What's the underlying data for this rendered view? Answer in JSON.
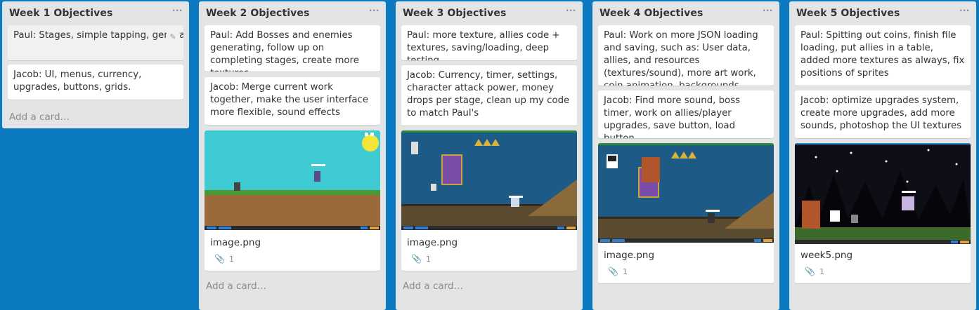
{
  "lists": [
    {
      "title": "Week 1 Objectives",
      "menu": "···",
      "cards": [
        {
          "text": "Paul: Stages, simple tapping, generate placeholder stages, timing."
        },
        {
          "text": "Jacob: UI, menus, currency, upgrades, buttons, grids."
        }
      ],
      "add_card": "Add a card…"
    },
    {
      "title": "Week 2 Objectives",
      "menu": "···",
      "cards": [
        {
          "text": "Paul: Add Bosses and enemies generating, follow up on completing stages, create more textures"
        },
        {
          "text": "Jacob: Merge current work together, make the user interface more flexible, sound effects"
        }
      ],
      "image": {
        "name": "image.png",
        "attachments": "1"
      },
      "add_card": "Add a card…"
    },
    {
      "title": "Week 3 Objectives",
      "menu": "···",
      "cards": [
        {
          "text": "Paul: more texture, allies code + textures, saving/loading, deep testing"
        },
        {
          "text": "Jacob: Currency, timer, settings, character attack power, money drops per stage, clean up my code to match Paul's"
        }
      ],
      "image": {
        "name": "image.png",
        "attachments": "1"
      },
      "add_card": "Add a card…"
    },
    {
      "title": "Week 4 Objectives",
      "menu": "···",
      "cards": [
        {
          "text": "Paul: Work on more JSON loading and saving, such as: User data, allies, and resources (textures/sound), more art work, coin animation, backgrounds"
        },
        {
          "text": "Jacob: Find more sound, boss timer, work on allies/player upgrades, save button, load button"
        }
      ],
      "image": {
        "name": "image.png",
        "attachments": "1"
      }
    },
    {
      "title": "Week 5 Objectives",
      "menu": "···",
      "cards": [
        {
          "text": "Paul: Spitting out coins, finish file loading, put allies in a table, added more textures as always, fix positions of sprites"
        },
        {
          "text": "Jacob: optimize upgrades system, create more upgrades, add more sounds, photoshop the UI textures"
        }
      ],
      "image": {
        "name": "week5.png",
        "attachments": "1"
      }
    }
  ],
  "icons": {
    "pencil": "pencil-icon",
    "paperclip": "paperclip-icon"
  },
  "colors": {
    "board_bg": "#0b79bf",
    "list_bg": "#e2e4e6",
    "card_bg": "#ffffff"
  }
}
